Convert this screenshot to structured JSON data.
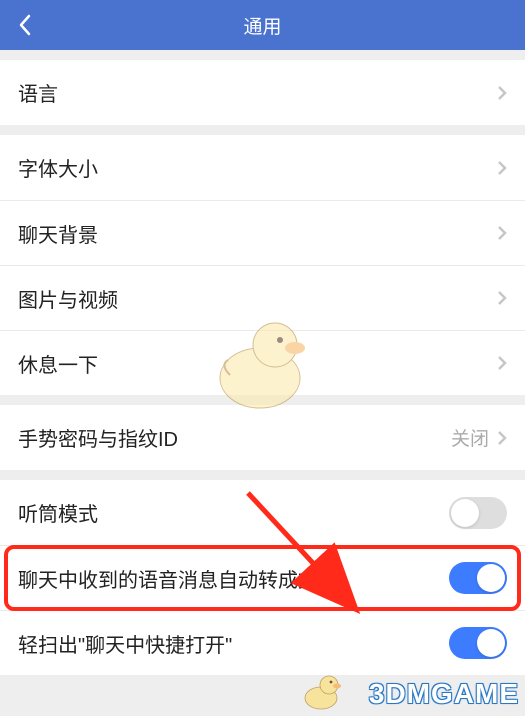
{
  "header": {
    "title": "通用"
  },
  "groups": [
    {
      "items": [
        {
          "label": "语言"
        }
      ]
    },
    {
      "items": [
        {
          "label": "字体大小"
        },
        {
          "label": "聊天背景"
        },
        {
          "label": "图片与视频"
        },
        {
          "label": "休息一下"
        }
      ]
    },
    {
      "items": [
        {
          "label": "手势密码与指纹ID",
          "value": "关闭"
        }
      ]
    },
    {
      "items": [
        {
          "label": "听筒模式",
          "toggle": "off"
        },
        {
          "label": "聊天中收到的语音消息自动转成文字",
          "toggle": "on",
          "highlighted": true
        },
        {
          "label": "轻扫出\"聊天中快捷打开\"",
          "toggle": "on"
        }
      ]
    }
  ],
  "watermark": "3DMGAME"
}
